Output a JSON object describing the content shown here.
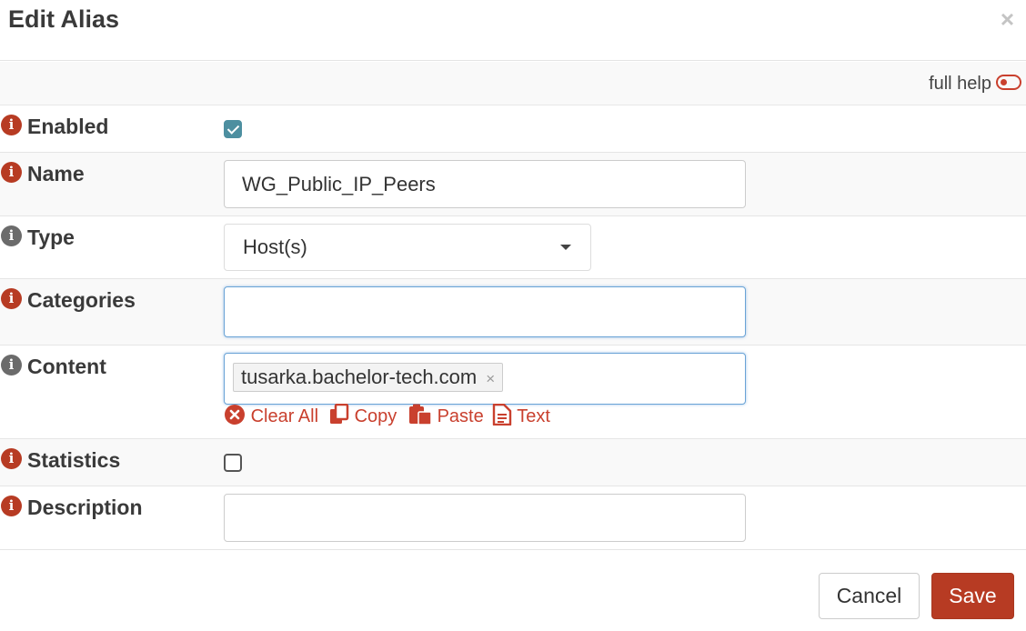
{
  "dialog": {
    "title": "Edit Alias",
    "close_symbol": "×"
  },
  "help": {
    "label": "full help",
    "toggle_on": false
  },
  "fields": {
    "enabled": {
      "label": "Enabled",
      "checked": true
    },
    "name": {
      "label": "Name",
      "value": "WG_Public_IP_Peers"
    },
    "type": {
      "label": "Type",
      "value": "Host(s)"
    },
    "categories": {
      "label": "Categories",
      "value": ""
    },
    "content": {
      "label": "Content",
      "token": "tusarka.bachelor-tech.com",
      "token_remove": "×",
      "actions": {
        "clear_all": "Clear All",
        "copy": "Copy",
        "paste": "Paste",
        "text": "Text"
      }
    },
    "statistics": {
      "label": "Statistics",
      "checked": false
    },
    "description": {
      "label": "Description",
      "value": ""
    }
  },
  "footer": {
    "cancel_label": "Cancel",
    "save_label": "Save"
  },
  "colors": {
    "accent": "#b73b23",
    "checkbox_checked": "#4d8fa0",
    "info_gray": "#6b6b6b"
  },
  "icons": {
    "info": "info-icon",
    "close": "close-icon",
    "toggle": "toggle-icon",
    "clear": "times-circle-icon",
    "copy": "copy-icon",
    "paste": "paste-icon",
    "text": "file-text-icon",
    "caret": "caret-down-icon"
  }
}
